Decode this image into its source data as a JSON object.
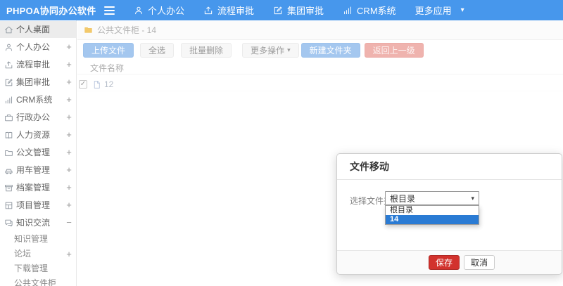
{
  "icons": {
    "caret_down": "▾",
    "check": "✓",
    "plus": "+",
    "minus": "−"
  },
  "colors": {
    "navbar_bg": "#4797ec",
    "toolbar_blue": "#a4c7ef",
    "toolbar_red": "#efb3ae",
    "save_red": "#d2322d",
    "option_highlight_blue": "#2a7bd4",
    "breadcrumb_folder_yellow": "#f3c96b"
  },
  "navbar": {
    "brand": "PHPOA协同办公软件",
    "items": [
      {
        "label": "个人办公",
        "icon": "user-icon"
      },
      {
        "label": "流程审批",
        "icon": "upload-icon"
      },
      {
        "label": "集团审批",
        "icon": "edit-icon"
      },
      {
        "label": "CRM系统",
        "icon": "chart-icon"
      },
      {
        "label": "更多应用",
        "icon": "caret-down-icon"
      }
    ]
  },
  "sidebar": {
    "items": [
      {
        "label": "个人桌面",
        "icon": "home-icon",
        "active": true
      },
      {
        "label": "个人办公",
        "icon": "user-icon",
        "expand": "+"
      },
      {
        "label": "流程审批",
        "icon": "upload-icon",
        "expand": "+"
      },
      {
        "label": "集团审批",
        "icon": "edit-icon",
        "expand": "+"
      },
      {
        "label": "CRM系统",
        "icon": "chart-icon",
        "expand": "+"
      },
      {
        "label": "行政办公",
        "icon": "briefcase-icon",
        "expand": "+"
      },
      {
        "label": "人力资源",
        "icon": "book-icon",
        "expand": "+"
      },
      {
        "label": "公文管理",
        "icon": "folder-icon",
        "expand": "+"
      },
      {
        "label": "用车管理",
        "icon": "car-icon",
        "expand": "+"
      },
      {
        "label": "档案管理",
        "icon": "archive-icon",
        "expand": "+"
      },
      {
        "label": "项目管理",
        "icon": "grid-icon",
        "expand": "+"
      },
      {
        "label": "知识交流",
        "icon": "chat-icon",
        "expand": "−",
        "children": [
          {
            "label": "知识管理"
          },
          {
            "label": "论坛",
            "expand": "+"
          },
          {
            "label": "下载管理"
          },
          {
            "label": "公共文件柜"
          }
        ]
      }
    ]
  },
  "breadcrumb": {
    "text": "公共文件柜 - 14"
  },
  "toolbar": {
    "buttons": [
      {
        "label": "上传文件",
        "style": "blue"
      },
      {
        "label": "全选",
        "style": "plain"
      },
      {
        "label": "批量删除",
        "style": "plain"
      },
      {
        "label": "更多操作",
        "style": "plain",
        "caret": true
      },
      {
        "label": "新建文件夹",
        "style": "blue"
      },
      {
        "label": "返回上一级",
        "style": "red"
      }
    ]
  },
  "table": {
    "header": "文件名称",
    "rows": [
      {
        "name": "12",
        "checked": true
      }
    ]
  },
  "modal": {
    "title": "文件移动",
    "field_label": "选择文件夹",
    "select_value": "根目录",
    "options": [
      {
        "label": "根目录",
        "highlighted": false
      },
      {
        "label": "14",
        "highlighted": true
      }
    ],
    "save_label": "保存",
    "cancel_label": "取消"
  }
}
